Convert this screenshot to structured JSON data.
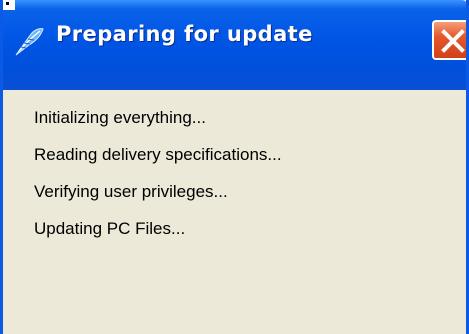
{
  "window": {
    "title": "Preparing for update"
  },
  "status_lines": [
    "Initializing everything...",
    "Reading delivery specifications...",
    "Verifying user privileges...",
    "Updating PC Files..."
  ],
  "icons": {
    "title_icon": "quill-feather-icon",
    "close_icon": "close-icon"
  },
  "colors": {
    "titlebar_blue": "#0055e5",
    "close_red": "#e6582b",
    "body_background": "#ece9d8"
  }
}
